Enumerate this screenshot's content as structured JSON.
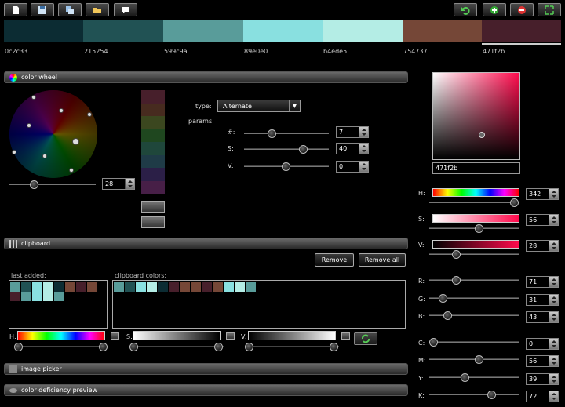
{
  "toolbar": {
    "left_icons": [
      "new-file-icon",
      "save-icon",
      "copy-icon",
      "folder-icon",
      "comment-icon"
    ],
    "right_icons": [
      "undo-icon",
      "add-icon",
      "remove-icon",
      "fullscreen-icon"
    ]
  },
  "palette": [
    {
      "hex": "0c2c33",
      "color": "#0c2c33"
    },
    {
      "hex": "215254",
      "color": "#215254"
    },
    {
      "hex": "599c9a",
      "color": "#599c9a"
    },
    {
      "hex": "89e0e0",
      "color": "#89e0e0"
    },
    {
      "hex": "b4ede5",
      "color": "#b4ede5"
    },
    {
      "hex": "754737",
      "color": "#754737"
    },
    {
      "hex": "471f2b",
      "color": "#471f2b"
    }
  ],
  "color_wheel": {
    "title": "color wheel",
    "slider_value": "28",
    "type_label": "type:",
    "type_value": "Alternate",
    "params_label": "params:",
    "params": [
      {
        "label": "#:",
        "value": "7"
      },
      {
        "label": "S:",
        "value": "40"
      },
      {
        "label": "V:",
        "value": "0"
      }
    ],
    "vertical_swatches": [
      "#471f2b",
      "#472b1f",
      "#3b471f",
      "#1f471f",
      "#1f473b",
      "#1f3b47",
      "#2b1f47",
      "#471f47"
    ]
  },
  "clipboard": {
    "title": "clipboard",
    "remove_label": "Remove",
    "remove_all_label": "Remove all",
    "last_added_label": "last added:",
    "clipboard_colors_label": "clipboard colors:",
    "last_added": [
      "#599c9a",
      "#215254",
      "#89e0e0",
      "#b4ede5",
      "#0c2c33",
      "#754737",
      "#471f2b",
      "#754737",
      "#471f2b",
      "#599c9a",
      "#89e0e0",
      "#b4ede5",
      "#599c9a"
    ],
    "clipboard_colors": [
      "#599c9a",
      "#215254",
      "#89e0e0",
      "#b4ede5",
      "#0c2c33",
      "#471f2b",
      "#754737",
      "#754737",
      "#471f2b",
      "#754737",
      "#89e0e0",
      "#b4ede5",
      "#599c9a"
    ],
    "h_label": "H:",
    "s_label": "S:",
    "v_label": "V:"
  },
  "image_picker": {
    "title": "image picker"
  },
  "deficiency": {
    "title": "color deficiency preview"
  },
  "picker": {
    "hex": "471f2b",
    "H": {
      "label": "H:",
      "value": "342"
    },
    "S": {
      "label": "S:",
      "value": "56"
    },
    "V": {
      "label": "V:",
      "value": "28"
    },
    "R": {
      "label": "R:",
      "value": "71"
    },
    "G": {
      "label": "G:",
      "value": "31"
    },
    "B": {
      "label": "B:",
      "value": "43"
    },
    "C": {
      "label": "C:",
      "value": "0"
    },
    "M": {
      "label": "M:",
      "value": "56"
    },
    "Y": {
      "label": "Y:",
      "value": "39"
    },
    "K": {
      "label": "K:",
      "value": "72"
    }
  }
}
